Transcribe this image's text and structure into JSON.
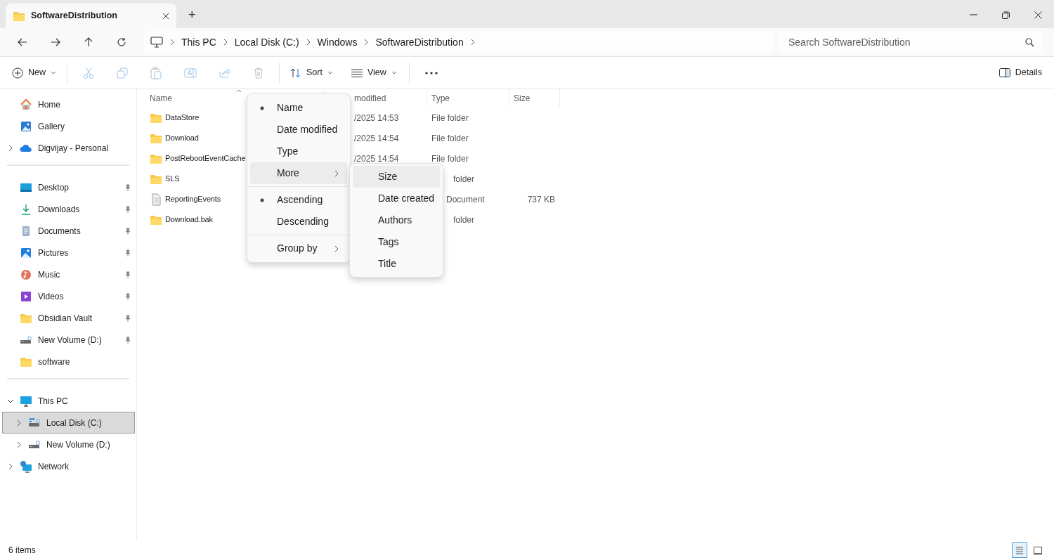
{
  "tabs": [
    {
      "title": "SoftwareDistribution",
      "selected": true
    }
  ],
  "new_tab": "+",
  "breadcrumb": [
    "This PC",
    "Local Disk (C:)",
    "Windows",
    "SoftwareDistribution"
  ],
  "search": {
    "placeholder": "Search SoftwareDistribution"
  },
  "toolbar": {
    "new": "New",
    "sort": "Sort",
    "view": "View",
    "details": "Details"
  },
  "sidebar": [
    [
      {
        "label": "Home",
        "kind": "home",
        "pinned": false,
        "expandable": false
      },
      {
        "label": "Gallery",
        "kind": "gallery",
        "pinned": false,
        "expandable": false
      },
      {
        "label": "Digvijay - Personal",
        "kind": "cloud",
        "pinned": false,
        "expandable": true,
        "expanded": false
      }
    ],
    [
      {
        "label": "Desktop",
        "kind": "desktop",
        "pinned": true
      },
      {
        "label": "Downloads",
        "kind": "downloads",
        "pinned": true
      },
      {
        "label": "Documents",
        "kind": "documents",
        "pinned": true
      },
      {
        "label": "Pictures",
        "kind": "pictures",
        "pinned": true
      },
      {
        "label": "Music",
        "kind": "music",
        "pinned": true
      },
      {
        "label": "Videos",
        "kind": "videos",
        "pinned": true
      },
      {
        "label": "Obsidian Vault",
        "kind": "folder",
        "pinned": true
      },
      {
        "label": "New Volume (D:)",
        "kind": "drive",
        "pinned": true
      },
      {
        "label": "software",
        "kind": "folder",
        "pinned": false
      }
    ],
    [
      {
        "label": "This PC",
        "kind": "pc",
        "expandable": true,
        "expanded": true,
        "selected": false,
        "children": [
          {
            "label": "Local Disk (C:)",
            "kind": "windrive",
            "expandable": true,
            "expanded": false,
            "selected": true
          },
          {
            "label": "New Volume (D:)",
            "kind": "drive",
            "expandable": true,
            "expanded": false,
            "selected": false
          }
        ]
      },
      {
        "label": "Network",
        "kind": "network",
        "expandable": true,
        "expanded": false,
        "selected": false
      }
    ]
  ],
  "columns": [
    "Name",
    "modified",
    "Type",
    "Size"
  ],
  "files": [
    {
      "name": "DataStore",
      "kind": "folder",
      "date": "/2025 14:53",
      "type": "File folder"
    },
    {
      "name": "Download",
      "kind": "folder",
      "date": "/2025 14:54",
      "type": "File folder"
    },
    {
      "name": "PostRebootEventCache",
      "kind": "folder",
      "date": "/2025 14:54",
      "type": "File folder"
    },
    {
      "name": "SLS",
      "kind": "folder",
      "type": "folder"
    },
    {
      "name": "ReportingEvents",
      "kind": "document",
      "type": "Document",
      "size": "737 KB"
    },
    {
      "name": "Download.bak",
      "kind": "folder",
      "type": "folder"
    }
  ],
  "sort_menu": [
    [
      {
        "label": "Name",
        "selected": true,
        "has_submenu": false,
        "hovered": false
      },
      {
        "label": "Date modified",
        "selected": false,
        "has_submenu": false,
        "hovered": false
      },
      {
        "label": "Type",
        "selected": false,
        "has_submenu": false,
        "hovered": false
      },
      {
        "label": "More",
        "selected": false,
        "has_submenu": true,
        "hovered": true
      }
    ],
    [
      {
        "label": "Ascending",
        "selected": true,
        "has_submenu": false,
        "hovered": false
      },
      {
        "label": "Descending",
        "selected": false,
        "has_submenu": false,
        "hovered": false
      }
    ],
    [
      {
        "label": "Group by",
        "selected": false,
        "has_submenu": true,
        "hovered": false
      }
    ]
  ],
  "more_menu": [
    {
      "label": "Size",
      "hovered": true
    },
    {
      "label": "Date created",
      "hovered": false
    },
    {
      "label": "Authors",
      "hovered": false
    },
    {
      "label": "Tags",
      "hovered": false
    },
    {
      "label": "Title",
      "hovered": false
    }
  ],
  "status_bar": {
    "count": "6 items",
    "views": [
      {
        "kind": "details",
        "selected": true
      },
      {
        "kind": "tiles",
        "selected": false
      }
    ]
  }
}
